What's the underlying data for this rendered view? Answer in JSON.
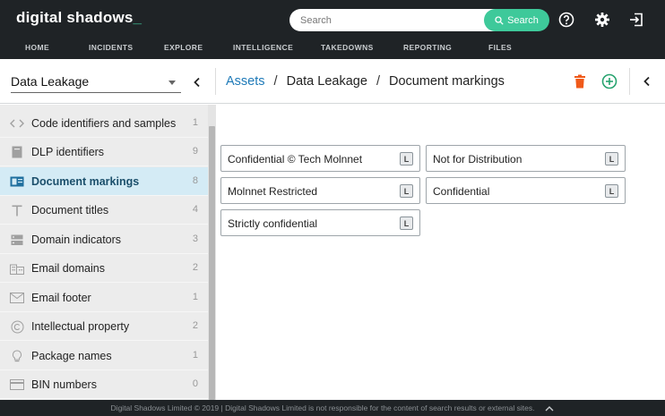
{
  "brand": {
    "name": "digital shadows",
    "cursor": "_"
  },
  "search": {
    "placeholder": "Search",
    "button_label": "Search"
  },
  "icons": {
    "help": "help-circle-icon",
    "settings": "gear-icon",
    "logout": "logout-icon",
    "search": "search-icon",
    "trash": "trash-icon",
    "add": "plus-circle-icon",
    "collapse": "chevron-left-icon"
  },
  "nav": [
    "HOME",
    "INCIDENTS",
    "EXPLORE",
    "INTELLIGENCE",
    "TAKEDOWNS",
    "REPORTING",
    "FILES"
  ],
  "category_select": {
    "value": "Data Leakage"
  },
  "breadcrumb": {
    "root": "Assets",
    "section": "Data Leakage",
    "current": "Document markings",
    "separator": "/"
  },
  "sidebar": {
    "items": [
      {
        "label": "Code identifiers and samples",
        "count": "1",
        "icon": "code-icon",
        "active": false
      },
      {
        "label": "DLP identifiers",
        "count": "9",
        "icon": "document-icon",
        "active": false
      },
      {
        "label": "Document markings",
        "count": "8",
        "icon": "marked-document-icon",
        "active": true
      },
      {
        "label": "Document titles",
        "count": "4",
        "icon": "title-icon",
        "active": false
      },
      {
        "label": "Domain indicators",
        "count": "3",
        "icon": "server-icon",
        "active": false
      },
      {
        "label": "Email domains",
        "count": "2",
        "icon": "building-icon",
        "active": false
      },
      {
        "label": "Email footer",
        "count": "1",
        "icon": "envelope-icon",
        "active": false
      },
      {
        "label": "Intellectual property",
        "count": "2",
        "icon": "copyright-icon",
        "active": false
      },
      {
        "label": "Package names",
        "count": "1",
        "icon": "lightbulb-icon",
        "active": false
      },
      {
        "label": "BIN numbers",
        "count": "0",
        "icon": "card-icon",
        "active": false
      }
    ]
  },
  "markings": [
    {
      "label": "Confidential © Tech Molnnet",
      "badge": "L"
    },
    {
      "label": "Not for Distribution",
      "badge": "L"
    },
    {
      "label": "Molnnet Restricted",
      "badge": "L"
    },
    {
      "label": "Confidential",
      "badge": "L"
    },
    {
      "label": "Strictly confidential",
      "badge": "L"
    }
  ],
  "footer": {
    "text": "Digital Shadows Limited © 2019 | Digital Shadows Limited is not responsible for the content of search results or external sites."
  },
  "colors": {
    "accent": "#3ec99a",
    "link": "#1f7ab8",
    "danger": "#f05a1a",
    "topbar": "#1f2326",
    "active_item": "#d4ebf5"
  }
}
